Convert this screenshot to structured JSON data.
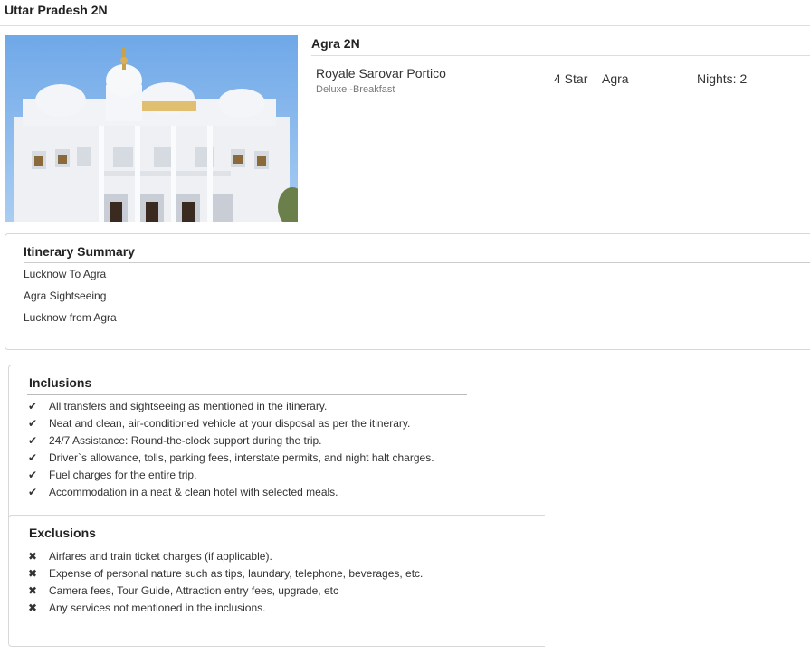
{
  "package": {
    "title": "Uttar Pradesh 2N"
  },
  "hero": {
    "image_alt": "Temple image"
  },
  "hotel": {
    "city_title": "Agra 2N",
    "name": "Royale Sarovar Portico",
    "room": "Deluxe -Breakfast",
    "star": "4 Star",
    "city": "Agra",
    "nights": "Nights: 2"
  },
  "itinerary": {
    "title": "Itinerary Summary",
    "items": [
      "Lucknow To Agra",
      "Agra Sightseeing",
      "Lucknow from Agra"
    ]
  },
  "inclusions": {
    "title": "Inclusions",
    "icon": "check-icon",
    "items": [
      "All transfers and sightseeing as mentioned in the itinerary.",
      "Neat and clean, air-conditioned vehicle at your disposal as per the itinerary.",
      "24/7 Assistance: Round-the-clock support during the trip.",
      "Driver`s allowance, tolls, parking fees, interstate permits, and night halt charges.",
      "Fuel charges for the entire trip.",
      "Accommodation in a neat & clean hotel with selected meals."
    ]
  },
  "exclusions": {
    "title": "Exclusions",
    "icon": "cross-icon",
    "items": [
      "Airfares and train ticket charges (if applicable).",
      "Expense of personal nature such as tips, laundary, telephone, beverages, etc.",
      "Camera fees, Tour Guide, Attraction entry fees, upgrade, etc",
      "Any services not mentioned in the inclusions."
    ]
  }
}
